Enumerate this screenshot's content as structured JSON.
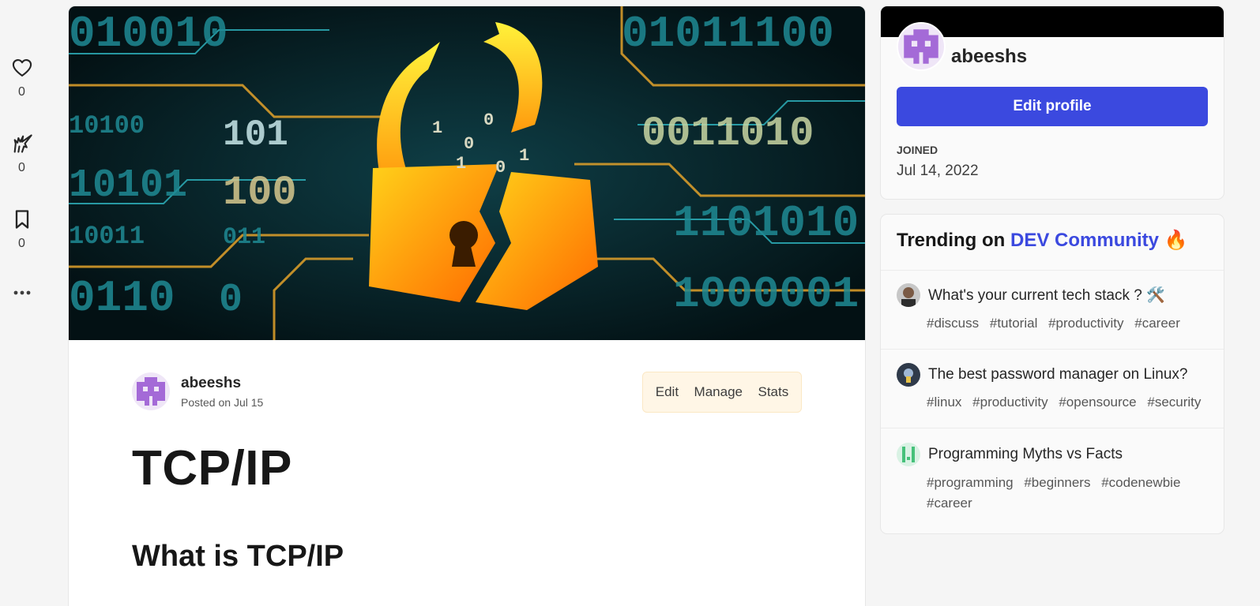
{
  "reactions": [
    {
      "icon": "heart-icon",
      "count": "0"
    },
    {
      "icon": "unicorn-icon",
      "count": "0"
    },
    {
      "icon": "bookmark-icon",
      "count": "0"
    },
    {
      "icon": "more-icon"
    }
  ],
  "cover": {
    "digits": [
      "010010",
      "01011100",
      "10100",
      "101",
      "0011010",
      "10101",
      "100",
      "1101010",
      "10011",
      "011",
      "1000001",
      "0110",
      "0"
    ]
  },
  "article": {
    "author": "abeeshs",
    "posted": "Posted on Jul 15",
    "actions": {
      "edit": "Edit",
      "manage": "Manage",
      "stats": "Stats"
    },
    "title": "TCP/IP",
    "heading": "What is TCP/IP"
  },
  "profile": {
    "name": "abeeshs",
    "edit_label": "Edit profile",
    "joined_label": "JOINED",
    "joined_date": "Jul 14, 2022"
  },
  "trending": {
    "prefix": "Trending on ",
    "community": "DEV Community",
    "emoji": "🔥",
    "items": [
      {
        "title": "What's your current tech stack ? 🛠️",
        "tags": [
          "#discuss",
          "#tutorial",
          "#productivity",
          "#career"
        ]
      },
      {
        "title": "The best password manager on Linux?",
        "tags": [
          "#linux",
          "#productivity",
          "#opensource",
          "#security"
        ]
      },
      {
        "title": "Programming Myths vs Facts",
        "tags": [
          "#programming",
          "#beginners",
          "#codenewbie",
          "#career"
        ]
      }
    ]
  },
  "colors": {
    "accent": "#3b49df",
    "avatar_purple": "#a46ad7",
    "cover_bg": "#061b21"
  }
}
